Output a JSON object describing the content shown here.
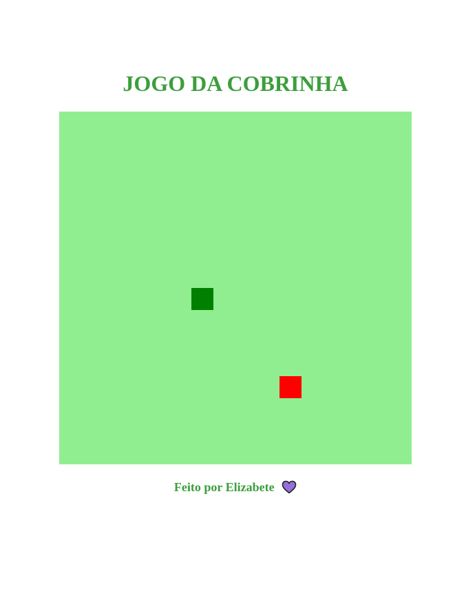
{
  "title": "JOGO DA COBRINHA",
  "game": {
    "grid_columns": 16,
    "grid_rows": 16,
    "board_color": "#90ee90",
    "snake": {
      "color": "#008000",
      "segments": [
        {
          "col": 6,
          "row": 8
        }
      ]
    },
    "food": {
      "color": "#ff0000",
      "col": 10,
      "row": 12
    }
  },
  "footer": {
    "text": "Feito por Elizabete",
    "icon": "heart-icon",
    "icon_color": "#9370db"
  }
}
